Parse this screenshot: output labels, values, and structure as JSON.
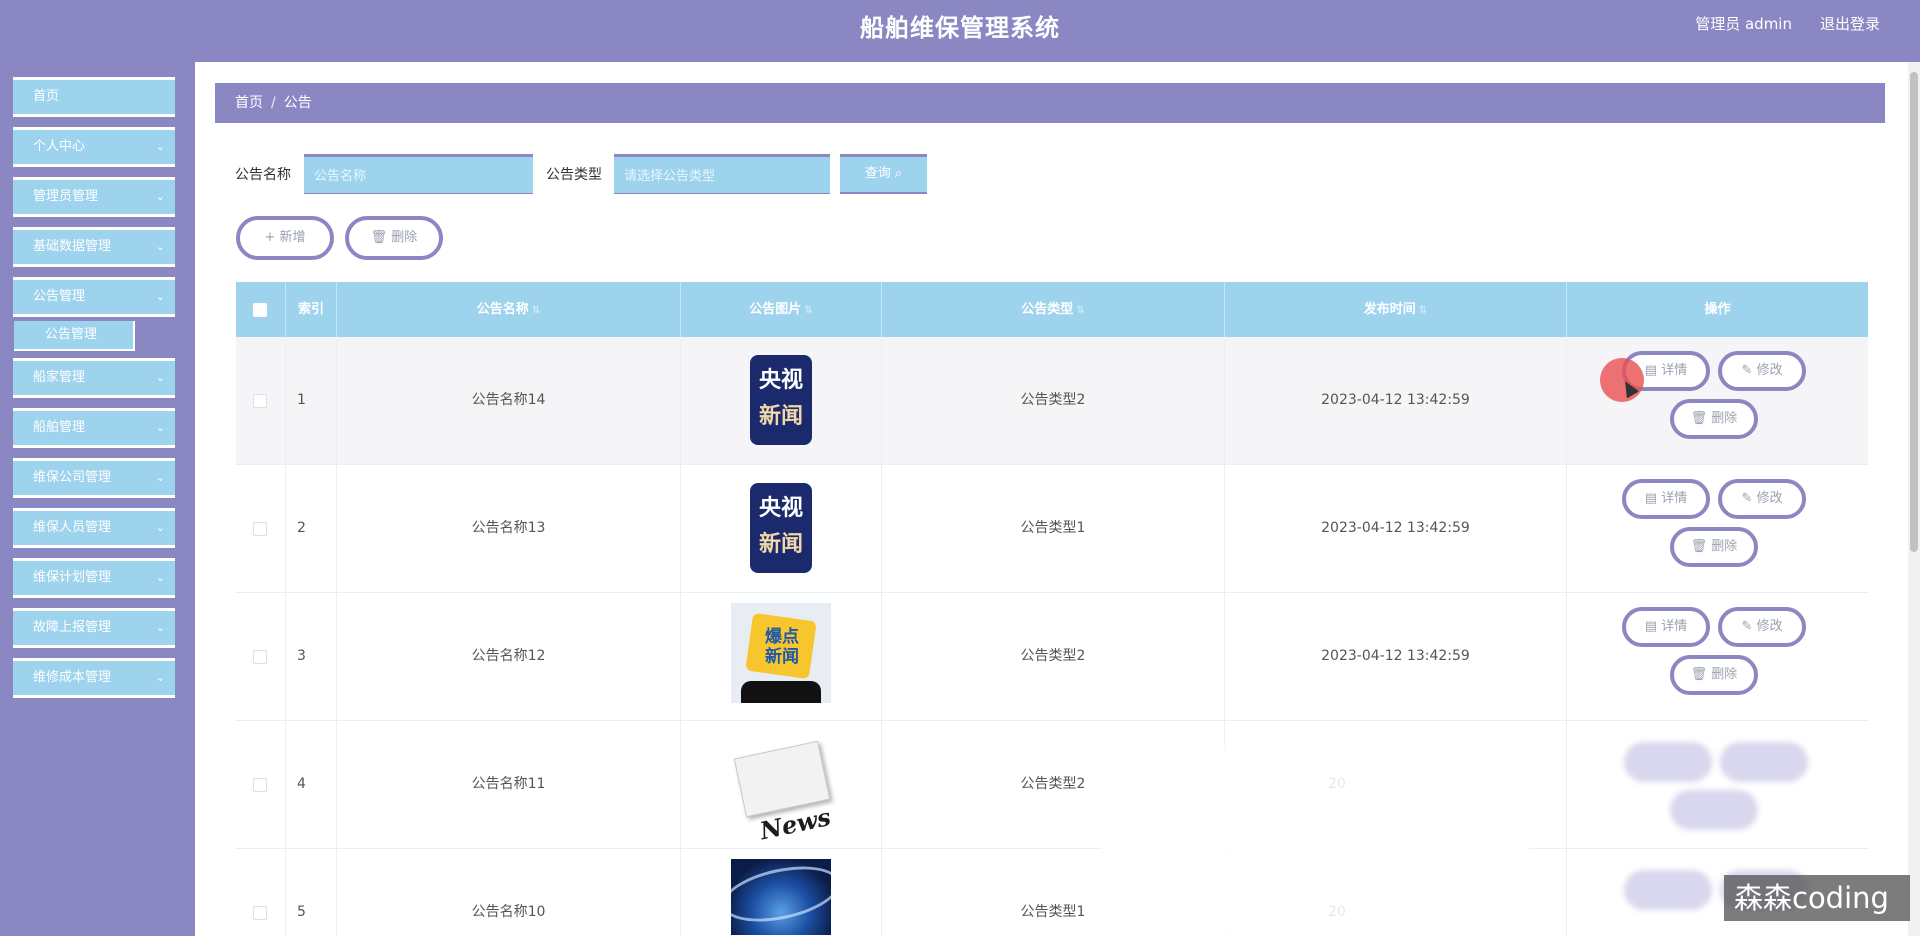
{
  "app": {
    "title": "船舶维保管理系统",
    "user": "管理员 admin",
    "logout": "退出登录"
  },
  "sidebar": {
    "items": [
      {
        "label": "首页"
      },
      {
        "label": "个人中心"
      },
      {
        "label": "管理员管理"
      },
      {
        "label": "基础数据管理"
      },
      {
        "label": "公告管理"
      },
      {
        "label": "船家管理"
      },
      {
        "label": "船舶管理"
      },
      {
        "label": "维保公司管理"
      },
      {
        "label": "维保人员管理"
      },
      {
        "label": "维保计划管理"
      },
      {
        "label": "故障上报管理"
      },
      {
        "label": "维修成本管理"
      }
    ],
    "sub_item": "公告管理",
    "chevron": "⌄"
  },
  "breadcrumb": {
    "home": "首页",
    "separator": "/",
    "current": "公告"
  },
  "search": {
    "name_label": "公告名称",
    "name_placeholder": "公告名称",
    "type_label": "公告类型",
    "type_placeholder": "请选择公告类型",
    "button": "查询 ⌕"
  },
  "toolbar": {
    "add": "+ 新增",
    "delete": "🗑 删除"
  },
  "table": {
    "headers": {
      "index": "索引",
      "name": "公告名称",
      "image": "公告图片",
      "type": "公告类型",
      "time": "发布时间",
      "actions": "操作"
    },
    "sort_icon": "⇅",
    "rows": [
      {
        "index": "1",
        "name": "公告名称14",
        "type": "公告类型2",
        "time": "2023-04-12 13:42:59",
        "image_text_1": "央视",
        "image_text_2": "新闻"
      },
      {
        "index": "2",
        "name": "公告名称13",
        "type": "公告类型1",
        "time": "2023-04-12 13:42:59",
        "image_text_1": "央视",
        "image_text_2": "新闻"
      },
      {
        "index": "3",
        "name": "公告名称12",
        "type": "公告类型2",
        "time": "2023-04-12 13:42:59",
        "image_text": "爆点新闻"
      },
      {
        "index": "4",
        "name": "公告名称11",
        "type": "公告类型2",
        "time": "20",
        "image_text": "News"
      },
      {
        "index": "5",
        "name": "公告名称10",
        "type": "公告类型1",
        "time": "20"
      }
    ],
    "actions": {
      "detail": "▤ 详情",
      "edit": "✎ 修改",
      "delete": "🗑 删除"
    }
  },
  "watermark": "森森coding",
  "colors": {
    "primary": "#8a87c3",
    "accent": "#9ed3ee"
  }
}
